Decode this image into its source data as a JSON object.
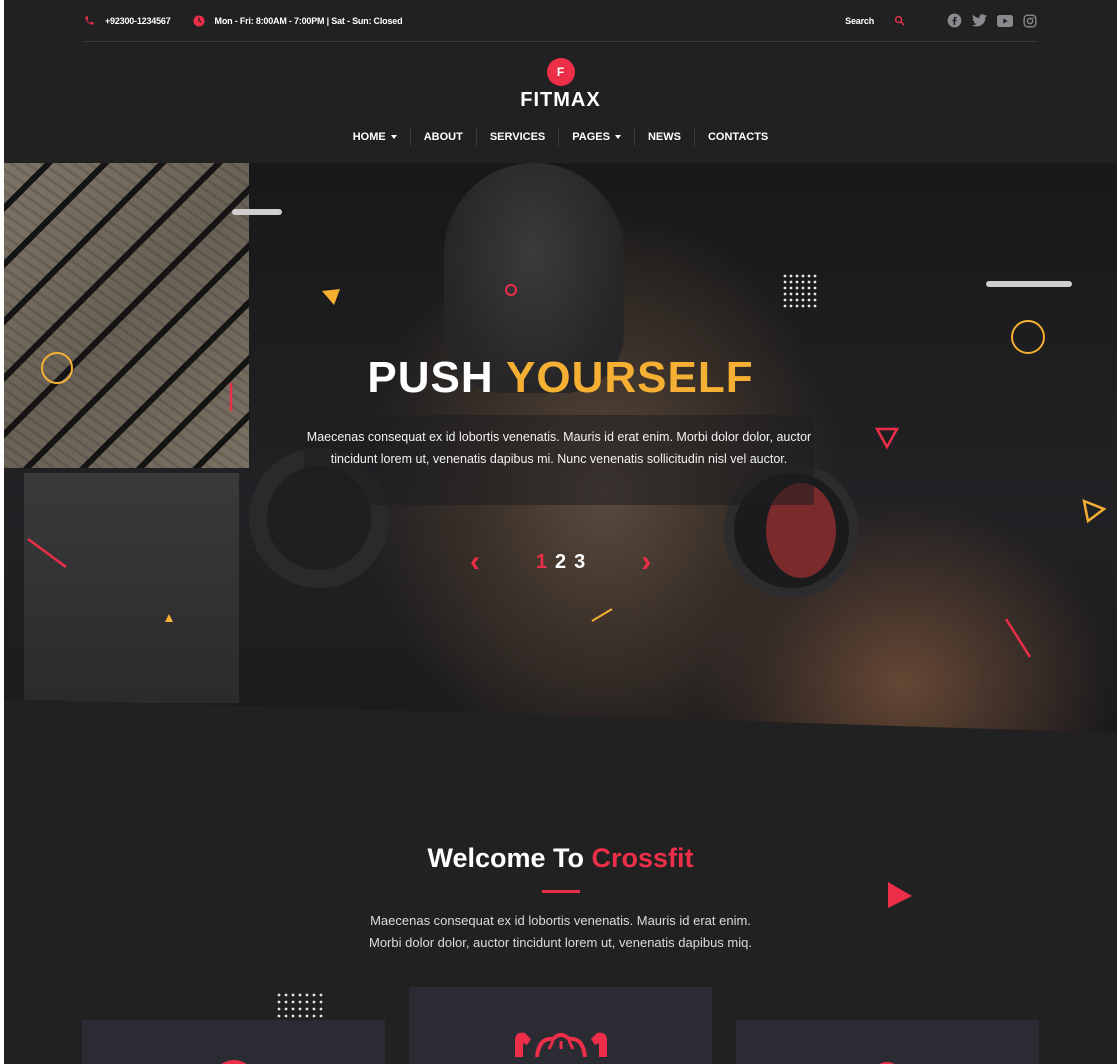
{
  "topbar": {
    "phone": "+92300-1234567",
    "hours": "Mon - Fri: 8:00AM - 7:00PM | Sat - Sun: Closed",
    "search_label": "Search",
    "socials": [
      "facebook-icon",
      "twitter-icon",
      "youtube-icon",
      "instagram-icon"
    ]
  },
  "logo": {
    "badge": "F",
    "name": "FITMAX"
  },
  "nav": {
    "items": [
      {
        "label": "HOME"
      },
      {
        "label": "ABOUT"
      },
      {
        "label": "SERVICES"
      },
      {
        "label": "PAGES"
      },
      {
        "label": "NEWS"
      },
      {
        "label": "CONTACTS"
      }
    ]
  },
  "hero": {
    "title_white": "PUSH",
    "title_accent": "YOURSELF",
    "description": "Maecenas consequat ex id lobortis venenatis. Mauris id erat enim. Morbi dolor dolor, auctor tincidunt lorem ut, venenatis dapibus mi. Nunc venenatis sollicitudin nisl vel auctor.",
    "prev_arrow": "‹",
    "next_arrow": "›",
    "slides": [
      "1",
      "2",
      "3"
    ]
  },
  "welcome": {
    "title_white": "Welcome To",
    "title_accent": "Crossfit",
    "text_line1": "Maecenas consequat ex id lobortis venenatis. Mauris id erat enim.",
    "text_line2": "Morbi dolor dolor, auctor tincidunt lorem ut, venenatis dapibus miq."
  },
  "colors": {
    "background": "#212122",
    "accent_red": "#ec2e48",
    "accent_yellow": "#f5b034",
    "card": "#2b2c33"
  }
}
